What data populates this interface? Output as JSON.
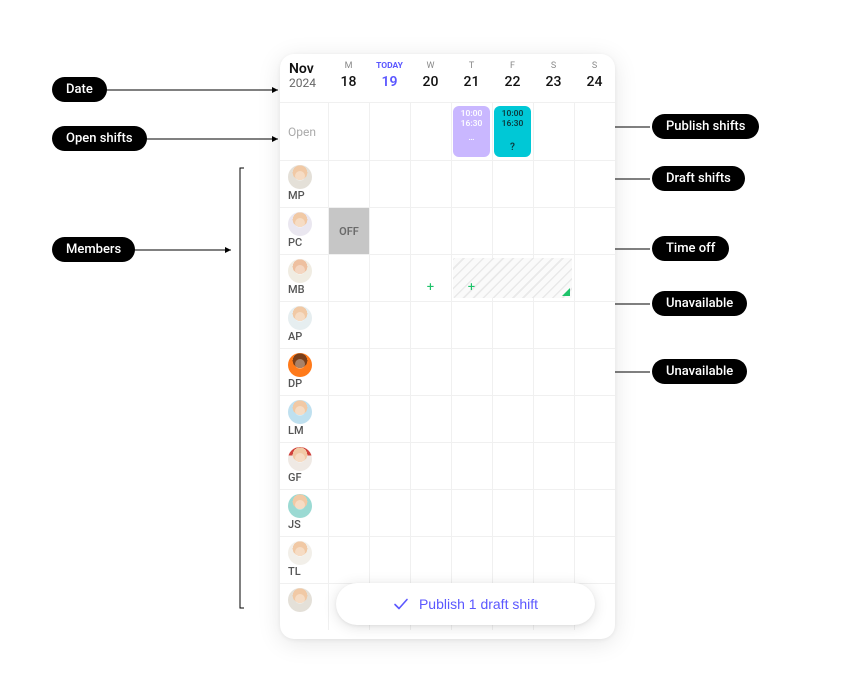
{
  "labels": {
    "date": "Date",
    "open_shifts": "Open shifts",
    "members": "Members",
    "publish_shifts": "Publish shifts",
    "draft_shifts": "Draft shifts",
    "time_off": "Time off",
    "unavailable_a": "Unavailable",
    "unavailable_b": "Unavailable"
  },
  "header": {
    "month": "Nov",
    "year": "2024",
    "days": [
      {
        "dow": "M",
        "num": "18",
        "today": false
      },
      {
        "dow": "TODAY",
        "num": "19",
        "today": true
      },
      {
        "dow": "W",
        "num": "20",
        "today": false
      },
      {
        "dow": "T",
        "num": "21",
        "today": false
      },
      {
        "dow": "F",
        "num": "22",
        "today": false
      },
      {
        "dow": "S",
        "num": "23",
        "today": false
      },
      {
        "dow": "S",
        "num": "24",
        "today": false
      }
    ]
  },
  "open_row": {
    "label": "Open",
    "shifts": {
      "draft": {
        "start": "10:00",
        "end": "16:30",
        "footer": "…"
      },
      "publish": {
        "start": "10:00",
        "end": "16:30",
        "footer": "?"
      }
    }
  },
  "members": [
    {
      "initials": "MP",
      "avatar": "skin1"
    },
    {
      "initials": "PC",
      "avatar": "skin2",
      "off_day": 0,
      "off_label": "OFF"
    },
    {
      "initials": "MB",
      "avatar": "skin3",
      "unavailable": [
        3,
        4,
        5
      ],
      "plus_days": [
        2,
        3
      ]
    },
    {
      "initials": "AP",
      "avatar": "skin4"
    },
    {
      "initials": "DP",
      "avatar": "orange"
    },
    {
      "initials": "LM",
      "avatar": "blue"
    },
    {
      "initials": "GF",
      "avatar": "red"
    },
    {
      "initials": "JS",
      "avatar": "teal"
    },
    {
      "initials": "TL",
      "avatar": "pale"
    }
  ],
  "publish_button": {
    "label": "Publish 1 draft shift"
  }
}
